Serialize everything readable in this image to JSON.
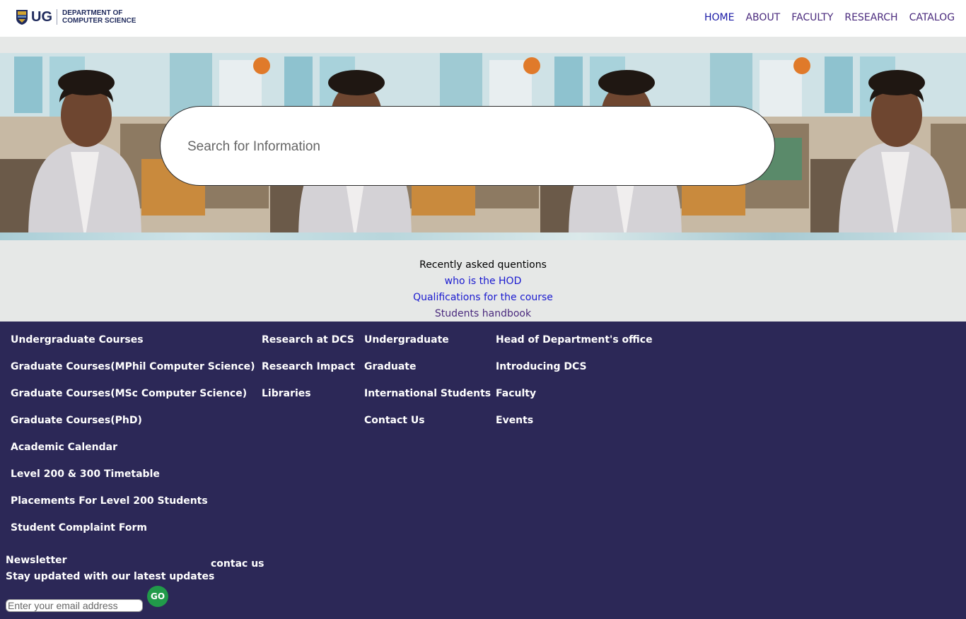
{
  "header": {
    "logo_text": "UG",
    "dept_line1": "DEPARTMENT OF",
    "dept_line2": "COMPUTER SCIENCE"
  },
  "nav": [
    "HOME",
    "ABOUT",
    "FACULTY",
    "RESEARCH",
    "CATALOG"
  ],
  "search": {
    "placeholder": "Search for Information"
  },
  "recent": {
    "title": "Recently asked quentions",
    "links": [
      "who is the HOD",
      "Qualifications for the course",
      "Students handbook"
    ]
  },
  "footer": {
    "col1": [
      "Undergraduate Courses",
      "Graduate Courses(MPhil Computer Science)",
      "Graduate Courses(MSc Computer Science)",
      "Graduate Courses(PhD)",
      "Academic Calendar",
      "Level 200 & 300 Timetable",
      "Placements For Level 200 Students",
      "Student Complaint Form"
    ],
    "col2": [
      "Research at DCS",
      "Research Impact",
      "Libraries"
    ],
    "col3": [
      "Undergraduate",
      "Graduate",
      "International Students",
      "Contact Us"
    ],
    "col4": [
      "Head of Department's office",
      "Introducing DCS",
      "Faculty",
      "Events"
    ],
    "newsletter_title": "Newsletter",
    "newsletter_sub": "Stay updated with our latest updates",
    "contact_label": "contac us",
    "email_placeholder": "Enter your email address",
    "go_label": "GO"
  },
  "colors": {
    "footer_bg": "#2c2857",
    "nav_active": "#1a1aa6",
    "nav_text": "#4a2a7d",
    "go_button": "#219a4a"
  }
}
